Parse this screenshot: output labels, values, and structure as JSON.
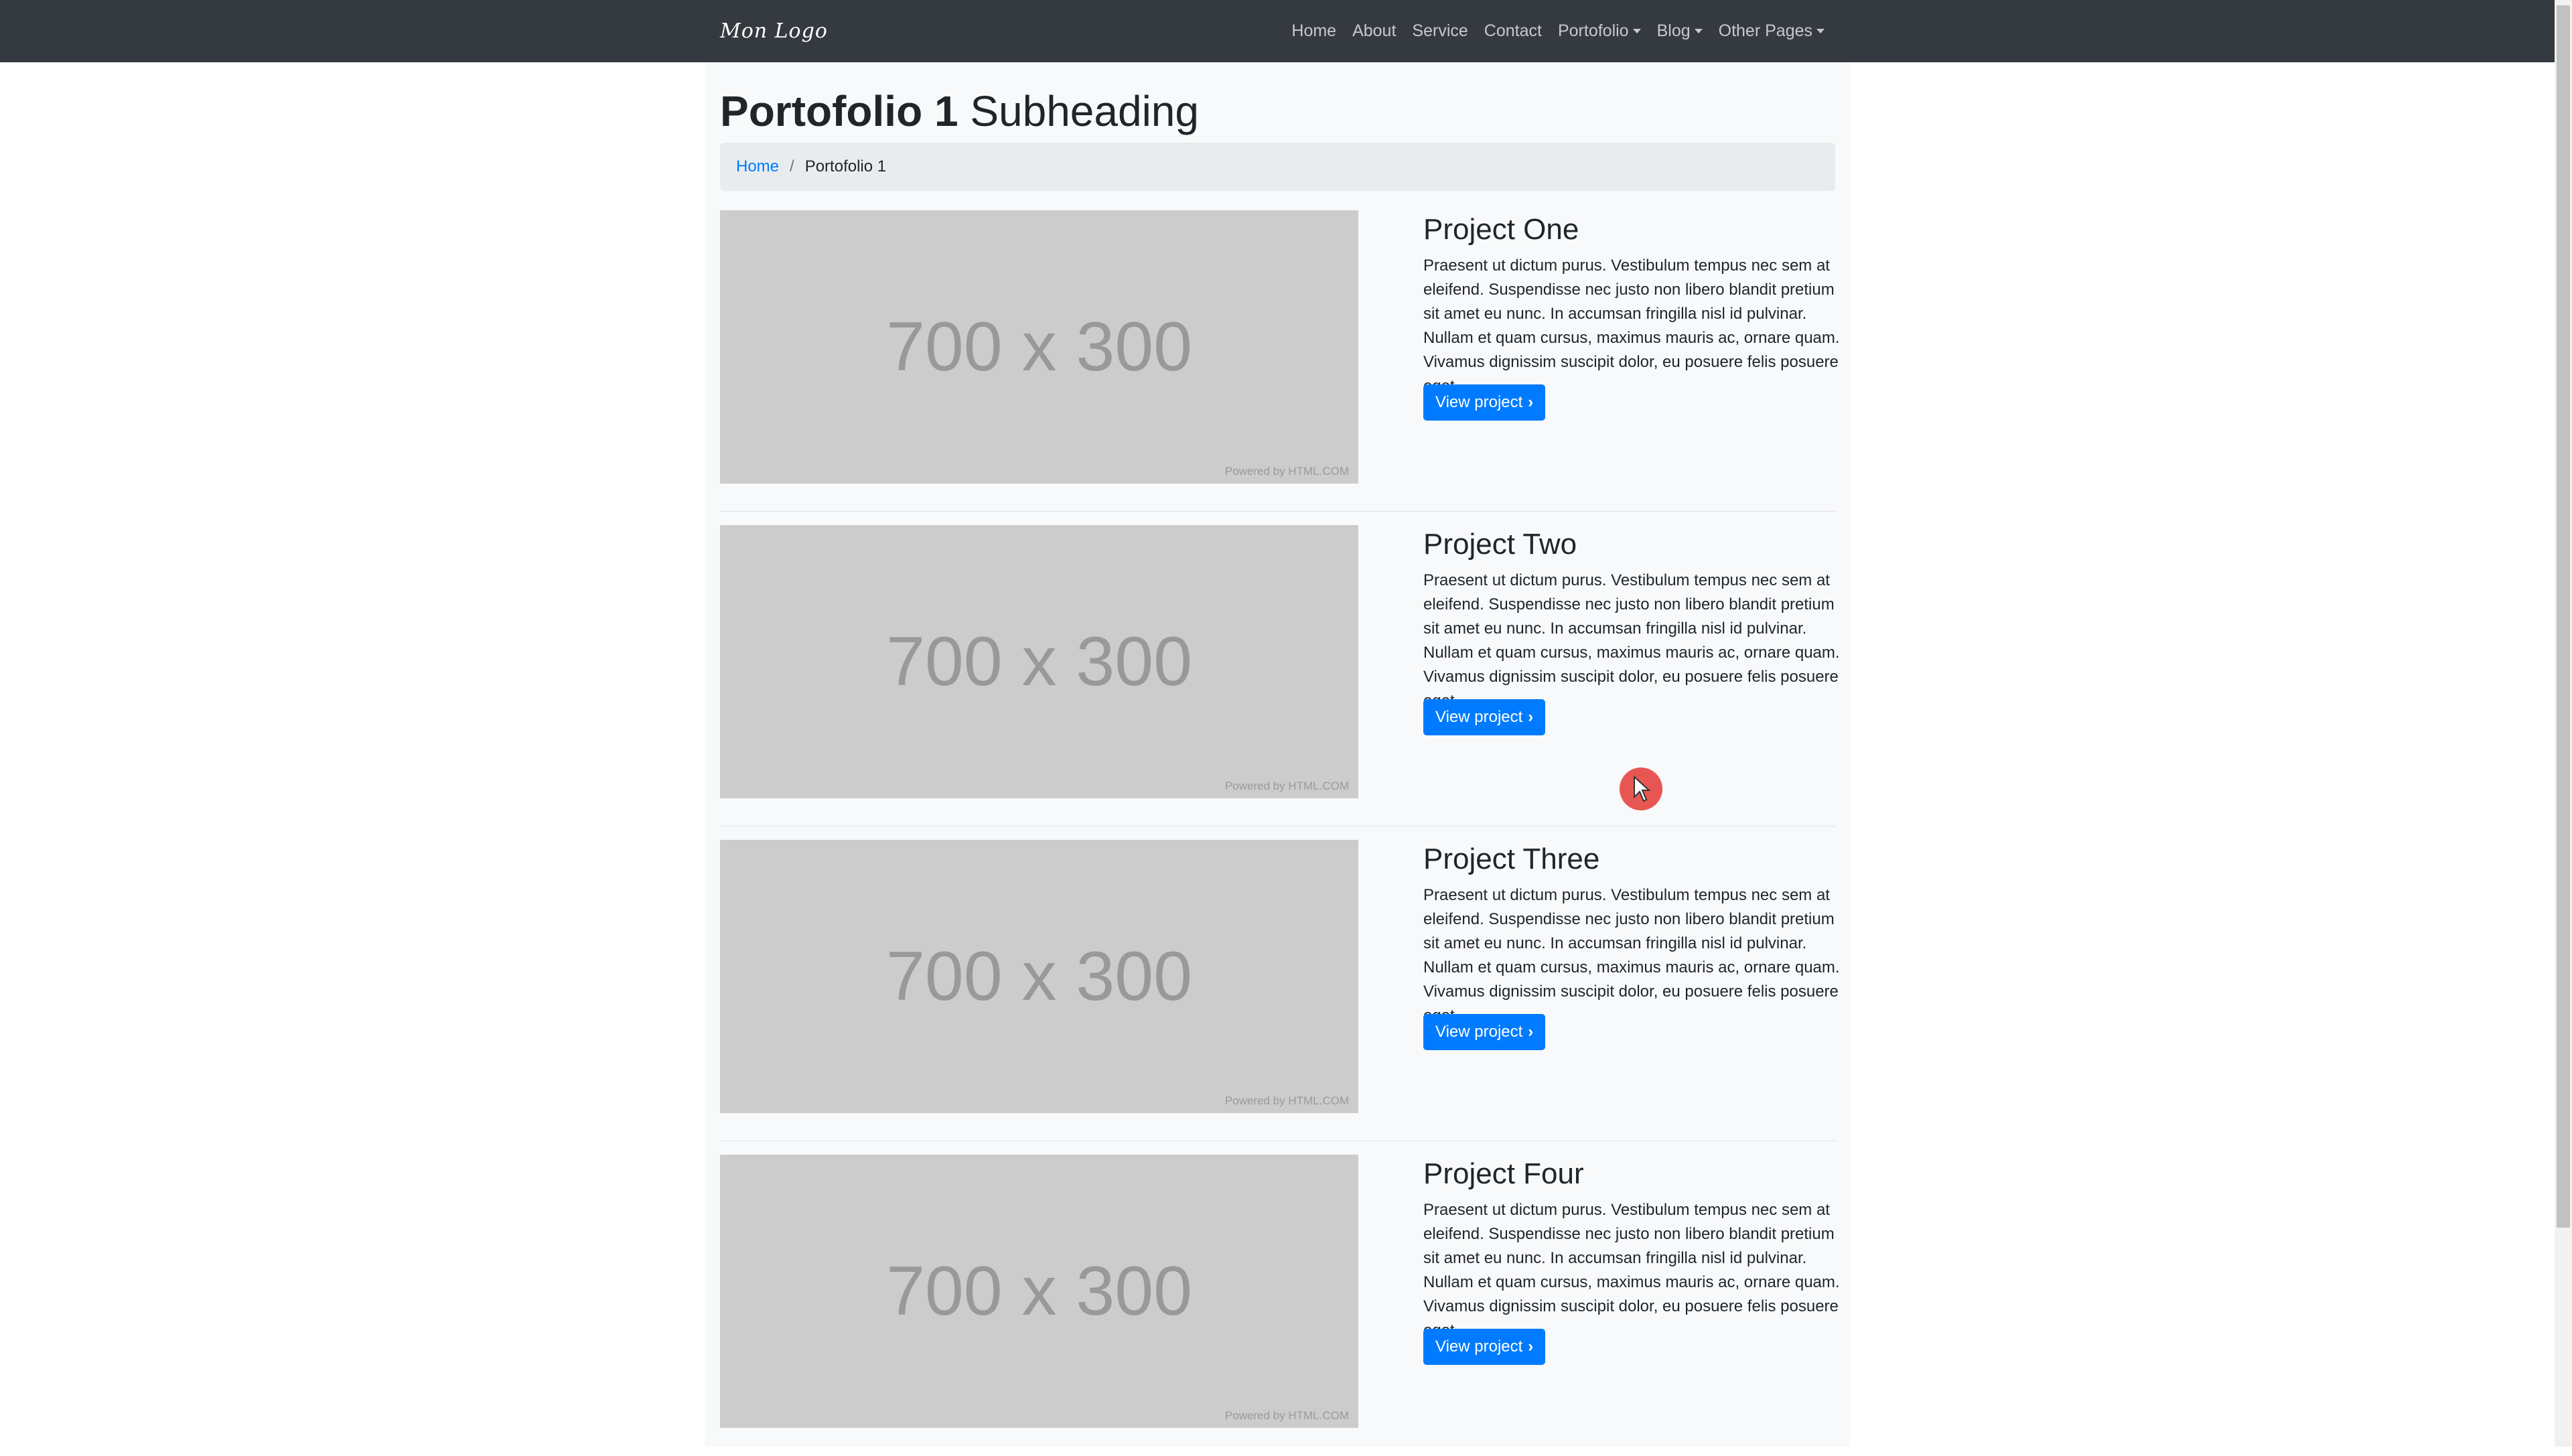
{
  "navbar": {
    "brand": "Mon Logo",
    "links": [
      {
        "label": "Home",
        "dropdown": false
      },
      {
        "label": "About",
        "dropdown": false
      },
      {
        "label": "Service",
        "dropdown": false
      },
      {
        "label": "Contact",
        "dropdown": false
      },
      {
        "label": "Portofolio",
        "dropdown": true
      },
      {
        "label": "Blog",
        "dropdown": true
      },
      {
        "label": "Other Pages",
        "dropdown": true
      }
    ]
  },
  "page": {
    "title": "Portofolio 1",
    "subtitle": "Subheading"
  },
  "breadcrumb": {
    "home": "Home",
    "separator": "/",
    "current": "Portofolio 1"
  },
  "projects": [
    {
      "title": "Project One",
      "image_label": "700 x 300",
      "image_credit": "Powered by HTML.COM",
      "description": "Praesent ut dictum purus. Vestibulum tempus nec sem at eleifend. Suspendisse nec justo non libero blandit pretium sit amet eu nunc. In accumsan fringilla nisl id pulvinar. Nullam et quam cursus, maximus mauris ac, ornare quam. Vivamus dignissim suscipit dolor, eu posuere felis posuere eget.",
      "button_label": "View project",
      "button_icon": "chevron-right-icon"
    },
    {
      "title": "Project Two",
      "image_label": "700 x 300",
      "image_credit": "Powered by HTML.COM",
      "description": "Praesent ut dictum purus. Vestibulum tempus nec sem at eleifend. Suspendisse nec justo non libero blandit pretium sit amet eu nunc. In accumsan fringilla nisl id pulvinar. Nullam et quam cursus, maximus mauris ac, ornare quam. Vivamus dignissim suscipit dolor, eu posuere felis posuere eget.",
      "button_label": "View project",
      "button_icon": "chevron-right-icon"
    },
    {
      "title": "Project Three",
      "image_label": "700 x 300",
      "image_credit": "Powered by HTML.COM",
      "description": "Praesent ut dictum purus. Vestibulum tempus nec sem at eleifend. Suspendisse nec justo non libero blandit pretium sit amet eu nunc. In accumsan fringilla nisl id pulvinar. Nullam et quam cursus, maximus mauris ac, ornare quam. Vivamus dignissim suscipit dolor, eu posuere felis posuere eget.",
      "button_label": "View project",
      "button_icon": "chevron-right-icon"
    },
    {
      "title": "Project Four",
      "image_label": "700 x 300",
      "image_credit": "Powered by HTML.COM",
      "description": "Praesent ut dictum purus. Vestibulum tempus nec sem at eleifend. Suspendisse nec justo non libero blandit pretium sit amet eu nunc. In accumsan fringilla nisl id pulvinar. Nullam et quam cursus, maximus mauris ac, ornare quam. Vivamus dignissim suscipit dolor, eu posuere felis posuere eget.",
      "button_label": "View project",
      "button_icon": "chevron-right-icon"
    }
  ],
  "colors": {
    "navbar_bg": "#343a40",
    "link": "#007bff",
    "button_bg": "#007bff",
    "placeholder_bg": "#cccccc",
    "cursor": "#e53935"
  }
}
